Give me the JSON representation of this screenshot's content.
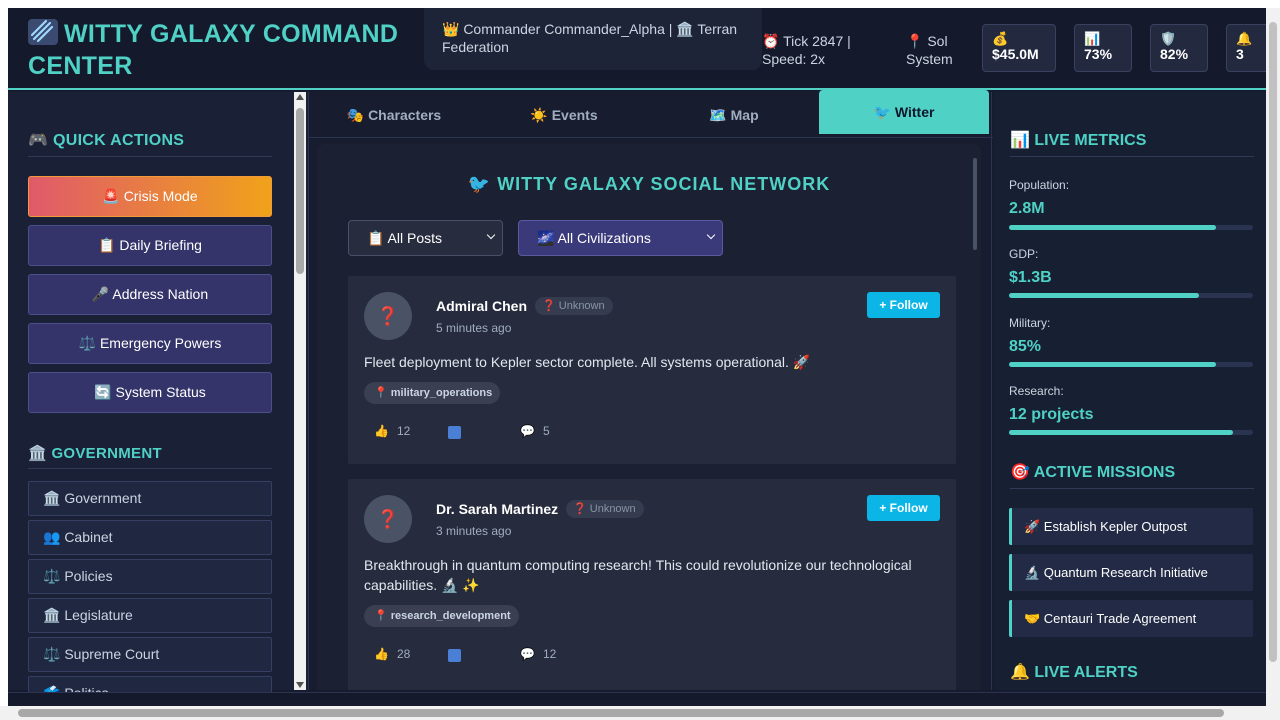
{
  "header": {
    "title": "WITTY GALAXY COMMAND CENTER",
    "commander": "👑 Commander Commander_Alpha | 🏛️ Terran Federation",
    "tick": "⏰ Tick 2847 | Speed: 2x",
    "location": "📍 Sol System",
    "stats": [
      {
        "icon": "💰",
        "value": "$45.0M"
      },
      {
        "icon": "📊",
        "value": "73%"
      },
      {
        "icon": "🛡️",
        "value": "82%"
      },
      {
        "icon": "🔔",
        "value": "3"
      }
    ]
  },
  "sidebar": {
    "quick_actions_heading": "🎮 QUICK ACTIONS",
    "quick_actions": [
      "🚨 Crisis Mode",
      "📋 Daily Briefing",
      "🎤 Address Nation",
      "⚖️ Emergency Powers",
      "🔄 System Status"
    ],
    "government_heading": "🏛️ GOVERNMENT",
    "government_items": [
      "🏛️ Government",
      "👥 Cabinet",
      "⚖️ Policies",
      "🏛️ Legislature",
      "⚖️ Supreme Court",
      "🗳️ Politics"
    ]
  },
  "tabs": [
    {
      "label": "🎭 Characters"
    },
    {
      "label": "☀️ Events"
    },
    {
      "label": "🗺️ Map"
    },
    {
      "label": "🐦 Witter"
    }
  ],
  "feed": {
    "title": "🐦 WITTY GALAXY SOCIAL NETWORK",
    "filter_posts": "📋 All Posts",
    "filter_civs": "🌌 All Civilizations",
    "posts": [
      {
        "author": "Admiral Chen",
        "badge": "❓ Unknown",
        "time": "5 minutes ago",
        "follow": "+ Follow",
        "text": "Fleet deployment to Kepler sector complete. All systems operational. 🚀",
        "tag": "📍 military_operations",
        "likes": "12",
        "comments": "5"
      },
      {
        "author": "Dr. Sarah Martinez",
        "badge": "❓ Unknown",
        "time": "3 minutes ago",
        "follow": "+ Follow",
        "text": "Breakthrough in quantum computing research! This could revolutionize our technological capabilities. 🔬 ✨",
        "tag": "📍 research_development",
        "likes": "28",
        "comments": "12"
      }
    ]
  },
  "metrics": {
    "heading": "📊 LIVE METRICS",
    "items": [
      {
        "label": "Population:",
        "value": "2.8M",
        "level": 0.85
      },
      {
        "label": "GDP:",
        "value": "$1.3B",
        "level": 0.78
      },
      {
        "label": "Military:",
        "value": "85%",
        "level": 0.85
      },
      {
        "label": "Research:",
        "value": "12 projects",
        "level": 0.92
      }
    ]
  },
  "missions": {
    "heading": "🎯 ACTIVE MISSIONS",
    "items": [
      "🚀 Establish Kepler Outpost",
      "🔬 Quantum Research Initiative",
      "🤝 Centauri Trade Agreement"
    ]
  },
  "alerts": {
    "heading": "🔔 LIVE ALERTS"
  }
}
